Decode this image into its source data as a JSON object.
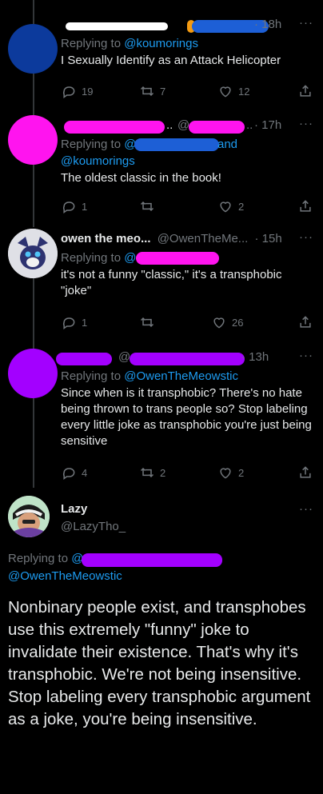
{
  "colors": {
    "blue_blob": "#1d5fd6",
    "magenta_blob": "#ff14ef",
    "purple_blob": "#a300ff",
    "link": "#1d9bf0"
  },
  "tweets": [
    {
      "time": "· 18h",
      "reply_prefix": "Replying to ",
      "reply_handle": "@koumorings",
      "text": "I Sexually Identify as an Attack Helicopter",
      "replies": "19",
      "retweets": "7",
      "likes": "12"
    },
    {
      "time": "· 17h",
      "header_dots": "..",
      "header_at": "@",
      "header_dots2": "..",
      "reply_prefix": "Replying to ",
      "reply_at": "@",
      "reply_and": "and",
      "reply_handle2": "@koumorings",
      "text": "The oldest classic in the book!",
      "replies": "1",
      "retweets": "",
      "likes": "2"
    },
    {
      "name": "owen the meo...",
      "handle": "@OwenTheMe...",
      "time": "· 15h",
      "reply_prefix": "Replying to ",
      "reply_at": "@",
      "text": "it's not a funny \"classic,\" it's a transphobic \"joke\"",
      "replies": "1",
      "retweets": "",
      "likes": "26"
    },
    {
      "header_at": "@",
      "time": "· 13h",
      "reply_prefix": "Replying to ",
      "reply_handle": "@OwenTheMeowstic",
      "text": "Since when is it transphobic? There's no hate being thrown to trans people so? Stop labeling every little joke as transphobic you're just being sensitive",
      "replies": "4",
      "retweets": "2",
      "likes": "2"
    }
  ],
  "main": {
    "name": "Lazy",
    "handle": "@LazyTho_",
    "reply_prefix": "Replying to ",
    "reply_at": "@",
    "reply_handle2": "@OwenTheMeowstic",
    "text": "Nonbinary people exist, and transphobes use this extremely \"funny\" joke to invalidate their existence. That's why it's transphobic. We're not being insensitive. Stop labeling every transphobic argument as a joke, you're being insensitive."
  },
  "more_glyph": "···"
}
